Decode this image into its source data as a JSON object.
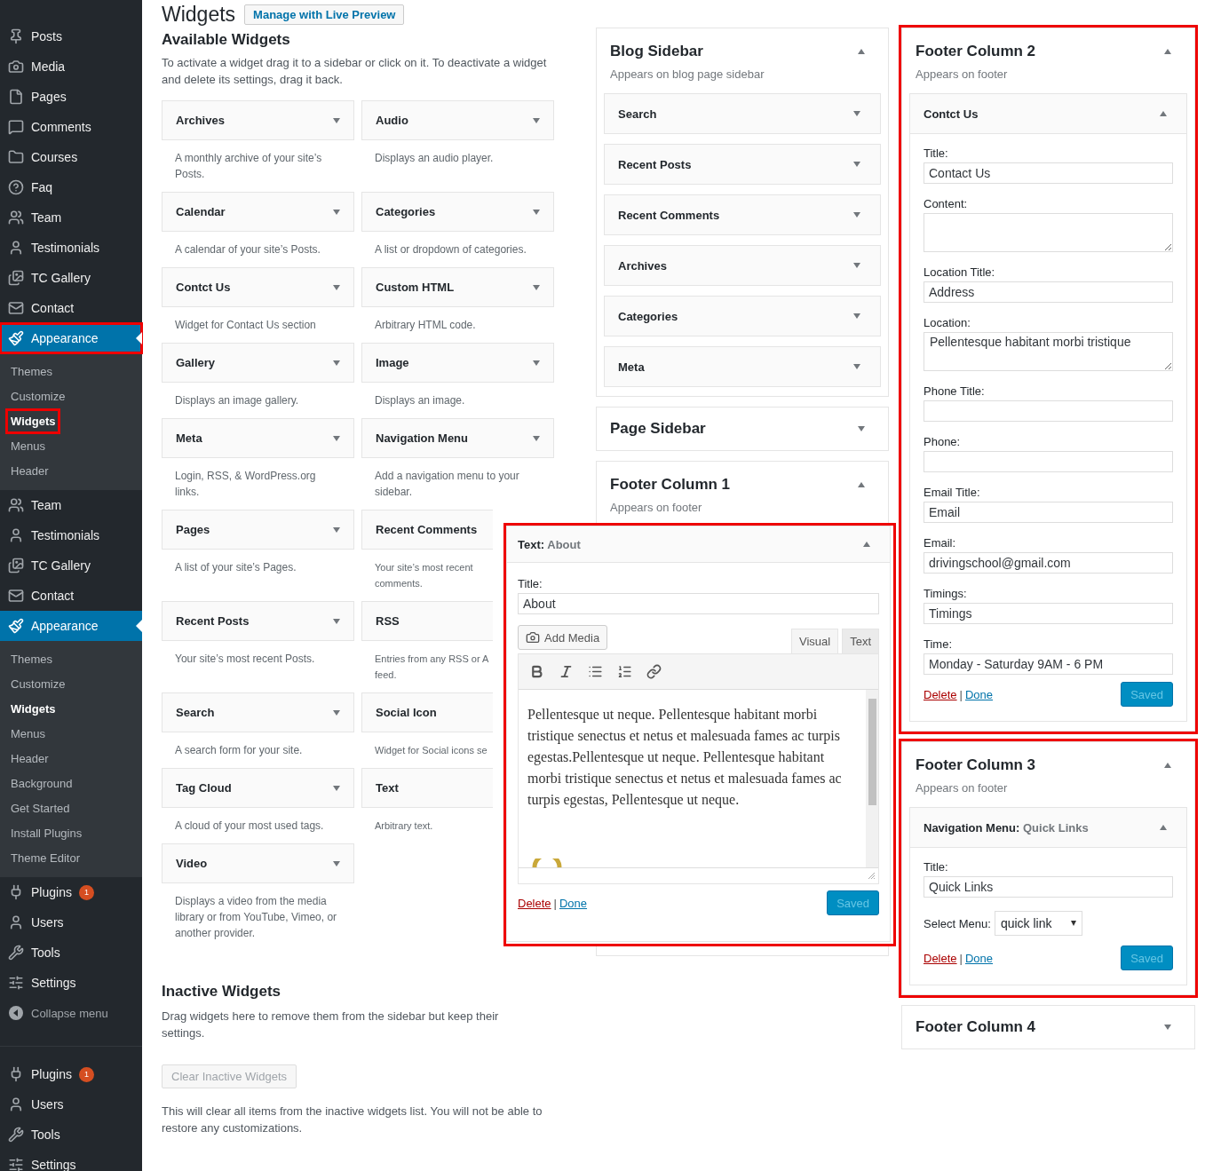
{
  "sidebar": {
    "sections": [
      {
        "items": [
          {
            "label": "Posts",
            "kind": "main",
            "selected": false,
            "highlighted": false
          },
          {
            "label": "Media",
            "kind": "main",
            "selected": false,
            "highlighted": false
          },
          {
            "label": "Pages",
            "kind": "main",
            "selected": false,
            "highlighted": false
          },
          {
            "label": "Comments",
            "kind": "main",
            "selected": false,
            "highlighted": false
          },
          {
            "label": "Courses",
            "kind": "main",
            "selected": false,
            "highlighted": false
          },
          {
            "label": "Faq",
            "kind": "main",
            "selected": false,
            "highlighted": false
          },
          {
            "label": "Team",
            "kind": "main",
            "selected": false,
            "highlighted": false
          },
          {
            "label": "Testimonials",
            "kind": "main",
            "selected": false,
            "highlighted": false
          },
          {
            "label": "TC Gallery",
            "kind": "main",
            "selected": false,
            "highlighted": false
          },
          {
            "label": "Contact",
            "kind": "main",
            "selected": false,
            "highlighted": false
          },
          {
            "label": "Appearance",
            "kind": "main",
            "selected": true,
            "highlighted": true,
            "children": [
              {
                "label": "Themes",
                "selected": false,
                "highlighted": false
              },
              {
                "label": "Customize",
                "selected": false,
                "highlighted": false
              },
              {
                "label": "Widgets",
                "selected": true,
                "highlighted": true
              },
              {
                "label": "Menus",
                "selected": false,
                "highlighted": false
              },
              {
                "label": "Header",
                "selected": false,
                "highlighted": false
              }
            ]
          },
          {
            "label": "Team",
            "kind": "main",
            "selected": false,
            "highlighted": false
          },
          {
            "label": "Testimonials",
            "kind": "main",
            "selected": false,
            "highlighted": false
          },
          {
            "label": "TC Gallery",
            "kind": "main",
            "selected": false,
            "highlighted": false
          },
          {
            "label": "Contact",
            "kind": "main",
            "selected": false,
            "highlighted": false
          },
          {
            "label": "Appearance",
            "kind": "main",
            "selected": true,
            "highlighted": false,
            "children": [
              {
                "label": "Themes",
                "selected": false,
                "highlighted": false
              },
              {
                "label": "Customize",
                "selected": false,
                "highlighted": false
              },
              {
                "label": "Widgets",
                "selected": true,
                "highlighted": false
              },
              {
                "label": "Menus",
                "selected": false,
                "highlighted": false
              },
              {
                "label": "Header",
                "selected": false,
                "highlighted": false
              },
              {
                "label": "Background",
                "selected": false,
                "highlighted": false
              },
              {
                "label": "Get Started",
                "selected": false,
                "highlighted": false
              },
              {
                "label": "Install Plugins",
                "selected": false,
                "highlighted": false
              },
              {
                "label": "Theme Editor",
                "selected": false,
                "highlighted": false
              }
            ]
          },
          {
            "label": "Plugins",
            "kind": "main",
            "selected": false,
            "highlighted": false,
            "badge": "1"
          },
          {
            "label": "Users",
            "kind": "main",
            "selected": false,
            "highlighted": false
          },
          {
            "label": "Tools",
            "kind": "main",
            "selected": false,
            "highlighted": false
          },
          {
            "label": "Settings",
            "kind": "main",
            "selected": false,
            "highlighted": false
          },
          {
            "label": "Collapse menu",
            "kind": "collapse",
            "selected": false,
            "highlighted": false
          }
        ]
      },
      {
        "items": [
          {
            "label": "Plugins",
            "kind": "main",
            "selected": false,
            "highlighted": false,
            "badge": "1"
          },
          {
            "label": "Users",
            "kind": "main",
            "selected": false,
            "highlighted": false
          },
          {
            "label": "Tools",
            "kind": "main",
            "selected": false,
            "highlighted": false
          },
          {
            "label": "Settings",
            "kind": "main",
            "selected": false,
            "highlighted": false
          }
        ]
      }
    ]
  },
  "page": {
    "title": "Widgets",
    "action": "Manage with Live Preview"
  },
  "available": {
    "title": "Available Widgets",
    "description": "To activate a widget drag it to a sidebar or click on it. To deactivate a widget and delete its settings, drag it back.",
    "widgets": [
      {
        "name": "Archives",
        "description": "A monthly archive of your site’s Posts.",
        "covered": false
      },
      {
        "name": "Audio",
        "description": "Displays an audio player.",
        "covered": false
      },
      {
        "name": "Calendar",
        "description": "A calendar of your site’s Posts.",
        "covered": false
      },
      {
        "name": "Categories",
        "description": "A list or dropdown of categories.",
        "covered": false
      },
      {
        "name": "Contct Us",
        "description": "Widget for Contact Us section",
        "covered": false
      },
      {
        "name": "Custom HTML",
        "description": "Arbitrary HTML code.",
        "covered": false
      },
      {
        "name": "Gallery",
        "description": "Displays an image gallery.",
        "covered": false
      },
      {
        "name": "Image",
        "description": "Displays an image.",
        "covered": false
      },
      {
        "name": "Meta",
        "description": "Login, RSS, & WordPress.org links.",
        "covered": false
      },
      {
        "name": "Navigation Menu",
        "description": "Add a navigation menu to your sidebar.",
        "covered": false
      },
      {
        "name": "Pages",
        "description": "A list of your site’s Pages.",
        "covered": false
      },
      {
        "name": "Recent Comments",
        "description": "Your site’s most recent\ncomments.",
        "covered": true
      },
      {
        "name": "Recent Posts",
        "description": "Your site’s most recent Posts.",
        "covered": false
      },
      {
        "name": "RSS",
        "description": "Entries from any RSS or A\nfeed.",
        "covered": true
      },
      {
        "name": "Search",
        "description": "A search form for your site.",
        "covered": false
      },
      {
        "name": "Social Icon",
        "description": "Widget for Social icons se",
        "covered": true
      },
      {
        "name": "Tag Cloud",
        "description": "A cloud of your most used tags.",
        "covered": false
      },
      {
        "name": "Text",
        "description": "Arbitrary text.",
        "covered": true
      },
      {
        "name": "Video",
        "description": "Displays a video from the media library or from YouTube, Vimeo, or another provider.",
        "covered": false
      }
    ]
  },
  "inactive": {
    "title": "Inactive Widgets",
    "description": "Drag widgets here to remove them from the sidebar but keep their settings.",
    "button": "Clear Inactive Widgets",
    "note": "This will clear all items from the inactive widgets list. You will not be able to restore any customizations."
  },
  "columns": [
    {
      "areas": [
        {
          "title": "Blog Sidebar",
          "description": "Appears on blog page sidebar",
          "expanded": true,
          "highlighted": false,
          "widgets": [
            {
              "name": "Search",
              "expanded": false
            },
            {
              "name": "Recent Posts",
              "expanded": false
            },
            {
              "name": "Recent Comments",
              "expanded": false
            },
            {
              "name": "Archives",
              "expanded": false
            },
            {
              "name": "Categories",
              "expanded": false
            },
            {
              "name": "Meta",
              "expanded": false
            }
          ]
        },
        {
          "title": "Page Sidebar",
          "expanded": false,
          "highlighted": false
        },
        {
          "title": "Footer Column 1",
          "description": "Appears on footer",
          "expanded": true,
          "highlighted": false,
          "widgets": [
            {
              "kind": "text",
              "name": "Text:",
              "instance": "About",
              "expanded": true,
              "highlighted": true,
              "fields": [
                {
                  "label": "Title:",
                  "value": "About",
                  "multiline": false
                }
              ],
              "add_media": "Add Media",
              "tabs": [
                {
                  "label": "Visual",
                  "selected": true
                },
                {
                  "label": "Text",
                  "selected": false
                }
              ],
              "content": "Pellentesque ut neque. Pellentesque habitant morbi tristique senectus et netus et malesuada fames ac turpis egestas.Pellentesque ut neque. Pellentesque habitant morbi tristique senectus et netus et malesuada fames ac turpis egestas, Pellentesque ut neque.",
              "delete": "Delete",
              "separator": "|",
              "done": "Done",
              "saved": "Saved"
            }
          ]
        }
      ]
    },
    {
      "areas": [
        {
          "title": "Footer Column 2",
          "description": "Appears on footer",
          "expanded": true,
          "highlighted": true,
          "widgets": [
            {
              "kind": "form",
              "name": "Contct Us",
              "expanded": true,
              "highlighted": false,
              "fields": [
                {
                  "label": "Title:",
                  "value": "Contact Us",
                  "multiline": false
                },
                {
                  "label": "Content:",
                  "multiline": true
                },
                {
                  "label": "Location Title:",
                  "value": "Address",
                  "multiline": false
                },
                {
                  "label": "Location:",
                  "value": "Pellentesque habitant morbi tristique",
                  "multiline": true
                },
                {
                  "label": "Phone Title:",
                  "multiline": false
                },
                {
                  "label": "Phone:",
                  "multiline": false
                },
                {
                  "label": "Email Title:",
                  "value": "Email",
                  "multiline": false
                },
                {
                  "label": "Email:",
                  "value": "drivingschool@gmail.com",
                  "multiline": false
                },
                {
                  "label": "Timings:",
                  "value": "Timings",
                  "multiline": false
                },
                {
                  "label": "Time:",
                  "value": "Monday - Saturday 9AM - 6 PM",
                  "multiline": false
                }
              ],
              "delete": "Delete",
              "separator": "|",
              "done": "Done",
              "saved": "Saved"
            }
          ]
        },
        {
          "title": "Footer Column 3",
          "description": "Appears on footer",
          "expanded": true,
          "highlighted": true,
          "widgets": [
            {
              "kind": "menu",
              "name": "Navigation Menu:",
              "instance": "Quick Links",
              "expanded": true,
              "highlighted": false,
              "fields": [
                {
                  "label": "Title:",
                  "value": "Quick Links",
                  "multiline": false
                }
              ],
              "select": {
                "label": "Select Menu:",
                "value": "quick link"
              },
              "delete": "Delete",
              "separator": "|",
              "done": "Done",
              "saved": "Saved"
            }
          ]
        },
        {
          "title": "Footer Column 4",
          "expanded": false,
          "highlighted": false
        }
      ]
    }
  ]
}
